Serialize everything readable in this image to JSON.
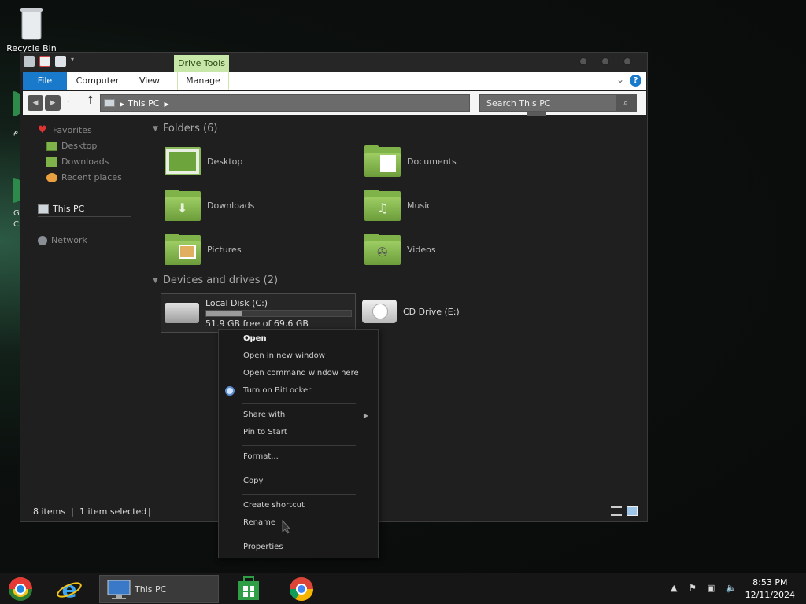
{
  "desktop": {
    "recycle_bin": "Recycle Bin",
    "partial_labels": [
      "م",
      "G",
      "C"
    ]
  },
  "window": {
    "title_context": "Drive Tools",
    "tabs": [
      "File",
      "Computer",
      "View",
      "Manage"
    ],
    "address_path": "This PC",
    "search_placeholder": "Search This PC"
  },
  "nav": {
    "favorites": "Favorites",
    "desktop": "Desktop",
    "downloads": "Downloads",
    "recent_places": "Recent places",
    "this_pc": "This PC",
    "network": "Network"
  },
  "content": {
    "folders_header": "Folders (6)",
    "folders": [
      "Desktop",
      "Documents",
      "Downloads",
      "Music",
      "Pictures",
      "Videos"
    ],
    "devices_header": "Devices and drives (2)",
    "drive_c_name": "Local Disk (C:)",
    "drive_c_free": "51.9 GB free of 69.6 GB",
    "drive_c_used_fraction": 0.25,
    "drive_e_name": "CD Drive (E:)"
  },
  "status": {
    "items": "8 items",
    "selected": "1 item selected"
  },
  "context_menu": {
    "open": "Open",
    "open_new_window": "Open in new window",
    "open_cmd": "Open command window here",
    "bitlocker": "Turn on BitLocker",
    "share_with": "Share with",
    "pin_start": "Pin to Start",
    "format": "Format...",
    "copy": "Copy",
    "create_shortcut": "Create shortcut",
    "rename": "Rename",
    "properties": "Properties"
  },
  "taskbar": {
    "active_app": "This PC",
    "time": "8:53 PM",
    "date": "12/11/2024"
  },
  "colors": {
    "file_tab": "#1979ca",
    "drive_tools": "#c6e7a8",
    "folder_green": "#7fb34a"
  }
}
